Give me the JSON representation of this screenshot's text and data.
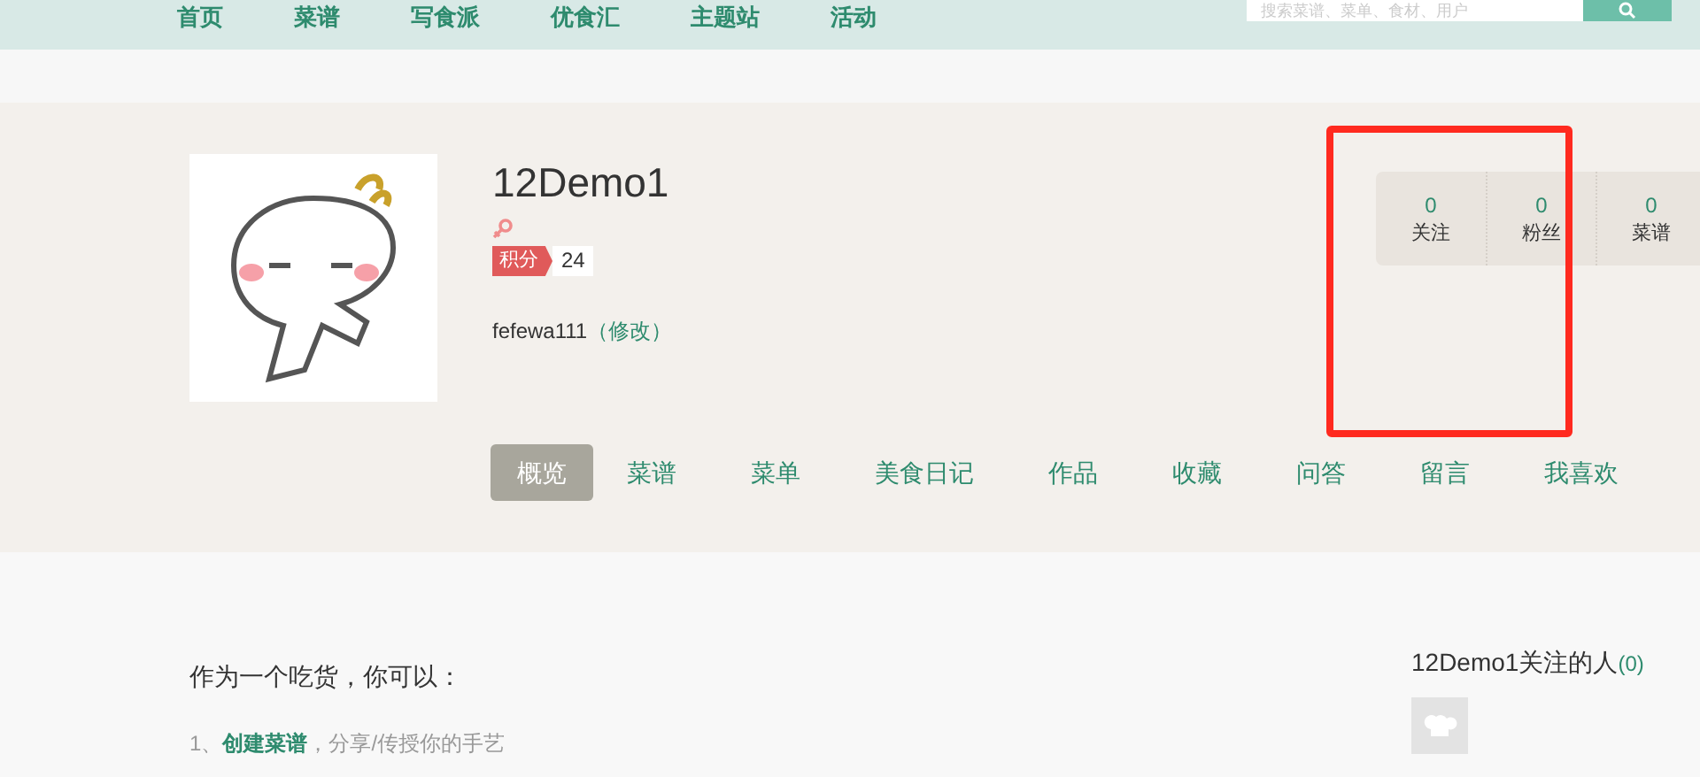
{
  "nav": {
    "items": [
      {
        "label": "首页"
      },
      {
        "label": "菜谱"
      },
      {
        "label": "写食派"
      },
      {
        "label": "优食汇"
      },
      {
        "label": "主题站"
      },
      {
        "label": "活动"
      }
    ],
    "search": {
      "placeholder": "搜索菜谱、菜单、食材、用户"
    }
  },
  "profile": {
    "name": "12Demo1",
    "score_label": "积分",
    "score": "24",
    "username": "fefewa111",
    "edit_link": "（修改）",
    "stats": [
      {
        "value": "0",
        "label": "关注"
      },
      {
        "value": "0",
        "label": "粉丝"
      },
      {
        "value": "0",
        "label": "菜谱"
      }
    ],
    "tabs": [
      {
        "label": "概览",
        "selected": true
      },
      {
        "label": "菜谱",
        "selected": false
      },
      {
        "label": "菜单",
        "selected": false
      },
      {
        "label": "美食日记",
        "selected": false
      },
      {
        "label": "作品",
        "selected": false
      },
      {
        "label": "收藏",
        "selected": false
      },
      {
        "label": "问答",
        "selected": false
      },
      {
        "label": "留言",
        "selected": false
      },
      {
        "label": "我喜欢",
        "selected": false
      }
    ]
  },
  "intro": {
    "heading": "作为一个吃货，你可以：",
    "items": [
      {
        "number": "1、",
        "link": "创建菜谱",
        "text": "，分享/传授你的手艺"
      }
    ]
  },
  "following": {
    "title": "12Demo1关注的人",
    "count": "(0)"
  }
}
